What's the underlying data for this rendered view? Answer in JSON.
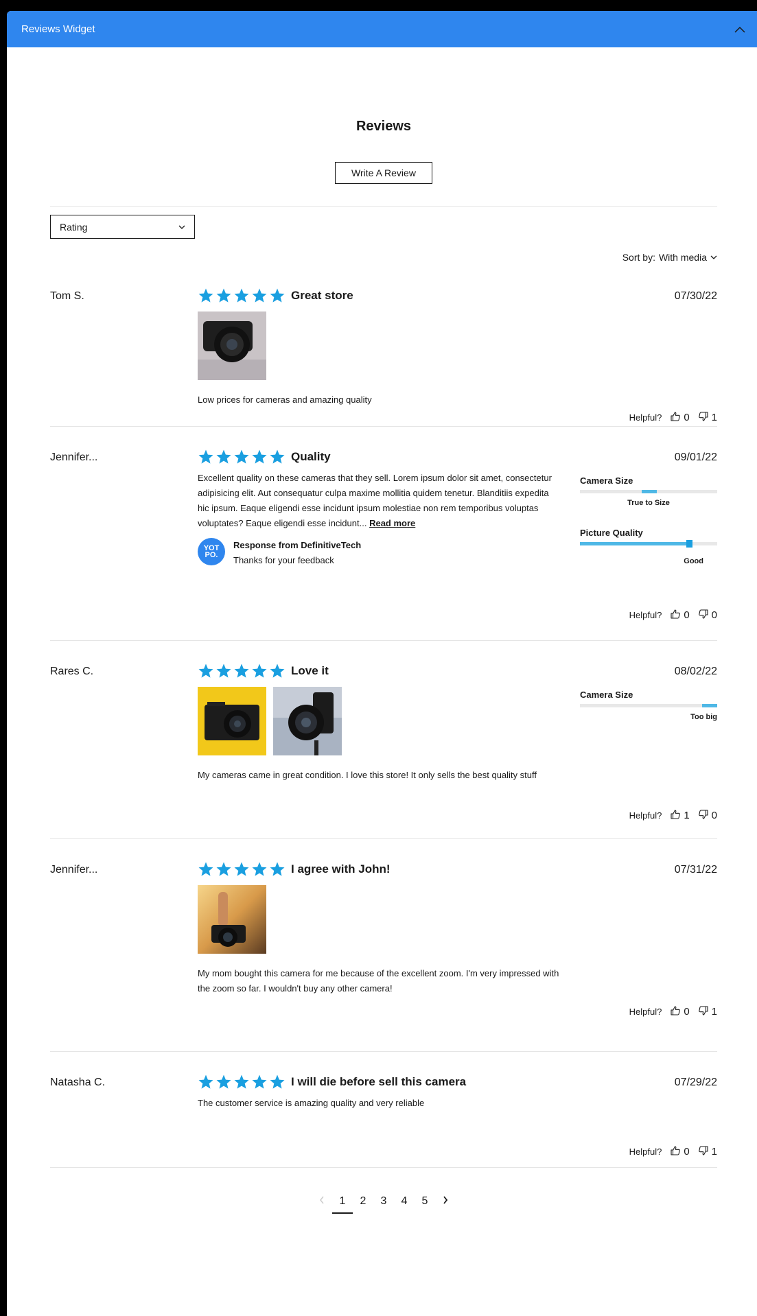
{
  "widget": {
    "title": "Reviews Widget"
  },
  "header": {
    "title": "Reviews",
    "write_review": "Write A Review"
  },
  "filter": {
    "label": "Rating"
  },
  "sort": {
    "label": "Sort by:",
    "value": "With media"
  },
  "helpful_label": "Helpful?",
  "reviews": [
    {
      "author": "Tom S.",
      "rating": 5,
      "title": "Great store",
      "date": "07/30/22",
      "body": "Low prices for cameras and amazing quality",
      "up": "0",
      "down": "1"
    },
    {
      "author": "Jennifer...",
      "rating": 5,
      "title": "Quality",
      "date": "09/01/22",
      "body": "Excellent quality on these cameras that they sell. Lorem ipsum dolor sit amet, consectetur adipisicing elit. Aut consequatur culpa maxime mollitia quidem tenetur. Blanditiis expedita hic ipsum. Eaque eligendi esse incidunt ipsum molestiae non rem temporibus voluptas voluptates? Eaque eligendi esse incidunt...",
      "read_more": "Read more",
      "response_title": "Response from DefinitiveTech",
      "response_text": "Thanks for your feedback",
      "logo_text": "YOT PO.",
      "up": "0",
      "down": "0",
      "properties": [
        {
          "name": "Camera Size",
          "label": "True to Size",
          "level": 0.5
        },
        {
          "name": "Picture Quality",
          "label": "Good",
          "level": 0.8
        }
      ]
    },
    {
      "author": "Rares C.",
      "rating": 5,
      "title": "Love it",
      "date": "08/02/22",
      "body": "My cameras came in great condition. I love this store! It only sells the best quality stuff",
      "up": "1",
      "down": "0",
      "properties": [
        {
          "name": "Camera Size",
          "label": "Too big",
          "level": 1.0
        }
      ]
    },
    {
      "author": "Jennifer...",
      "rating": 5,
      "title": "I agree with John!",
      "date": "07/31/22",
      "body": "My mom bought this camera for me because of the excellent zoom. I'm very impressed with the zoom so far. I wouldn't buy any other camera!",
      "up": "0",
      "down": "1"
    },
    {
      "author": "Natasha C.",
      "rating": 5,
      "title": "I will die before sell this camera",
      "date": "07/29/22",
      "body": "The customer service is amazing quality and very reliable",
      "up": "0",
      "down": "1"
    }
  ],
  "pagination": {
    "pages": [
      "1",
      "2",
      "3",
      "4",
      "5"
    ],
    "current": "1"
  },
  "colors": {
    "accent": "#2f86ee",
    "star": "#1a9fe0",
    "bar": "#4fb8e6"
  }
}
